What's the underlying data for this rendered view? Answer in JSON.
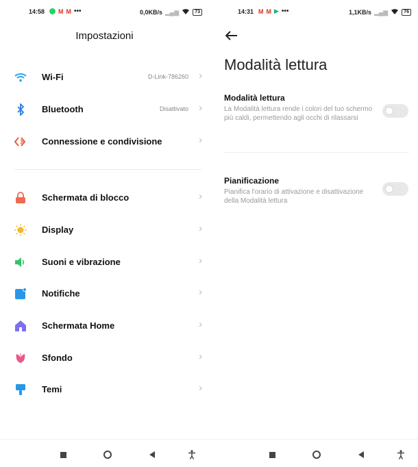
{
  "left": {
    "status": {
      "time": "14:58",
      "speed": "0,0KB/s",
      "battery": "73"
    },
    "title": "Impostazioni",
    "group1": [
      {
        "label": "Wi-Fi",
        "value": "D-Link-786260",
        "icon": "wifi-icon",
        "color": "#2aa5e8"
      },
      {
        "label": "Bluetooth",
        "value": "Disattivato",
        "icon": "bluetooth-icon",
        "color": "#2a7fe8"
      },
      {
        "label": "Connessione e condivisione",
        "value": "",
        "icon": "share-icon",
        "color": "#e85c3c"
      }
    ],
    "group2": [
      {
        "label": "Schermata di blocco",
        "icon": "lock-icon",
        "color": "#ef6a50"
      },
      {
        "label": "Display",
        "icon": "sun-icon",
        "color": "#f5b729"
      },
      {
        "label": "Suoni e vibrazione",
        "icon": "speaker-icon",
        "color": "#35c36a"
      },
      {
        "label": "Notifiche",
        "icon": "notification-icon",
        "color": "#2a96e8"
      },
      {
        "label": "Schermata Home",
        "icon": "home-icon",
        "color": "#7e6ff0"
      },
      {
        "label": "Sfondo",
        "icon": "flower-icon",
        "color": "#e9588b"
      },
      {
        "label": "Temi",
        "icon": "brush-icon",
        "color": "#2a96e8"
      }
    ]
  },
  "right": {
    "status": {
      "time": "14:31",
      "speed": "1,1KB/s",
      "battery": "76"
    },
    "title": "Modalità lettura",
    "settings": [
      {
        "title": "Modalità lettura",
        "desc": "La Modalità lettura rende i colori del tuo schermo più caldi, permettendo agli occhi di rilassarsi",
        "on": false
      },
      {
        "title": "Pianificazione",
        "desc": "Pianifica l'orario di attivazione e disattivazione della Modalità lettura",
        "on": false
      }
    ]
  }
}
